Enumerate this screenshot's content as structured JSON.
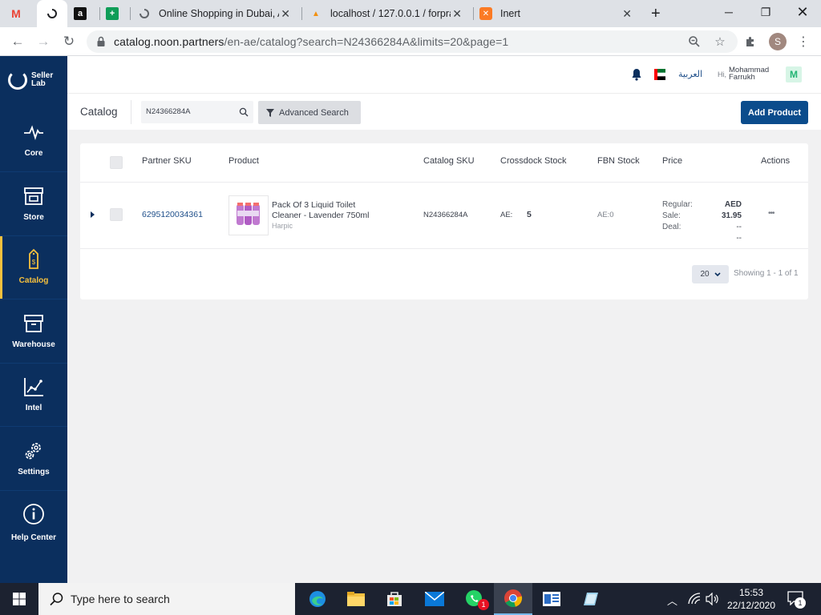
{
  "browser": {
    "tabs": [
      {
        "title": "",
        "icon": "gmail-icon"
      },
      {
        "title": "",
        "icon": "noon-loading-icon"
      },
      {
        "title": "",
        "icon": "amazon-icon"
      },
      {
        "title": "",
        "icon": "sheets-icon"
      },
      {
        "title": "Online Shopping in Dubai, A",
        "icon": "loading-icon"
      },
      {
        "title": "localhost / 127.0.0.1 / forpra",
        "icon": "phpmyadmin-icon"
      },
      {
        "title": "Inert",
        "icon": "xampp-icon"
      }
    ],
    "new_tab": "+",
    "url_host": "catalog.noon.partners",
    "url_path": "/en-ae/catalog?search=N24366284A&limits=20&page=1",
    "profile_initial": "S"
  },
  "sidebar": {
    "logo_line1": "Seller",
    "logo_line2": "Lab",
    "items": [
      {
        "label": "Core",
        "icon": "pulse-icon"
      },
      {
        "label": "Store",
        "icon": "store-icon"
      },
      {
        "label": "Catalog",
        "icon": "price-tag-icon",
        "active": true
      },
      {
        "label": "Warehouse",
        "icon": "warehouse-box-icon"
      },
      {
        "label": "Intel",
        "icon": "line-chart-icon"
      },
      {
        "label": "Settings",
        "icon": "gears-icon"
      },
      {
        "label": "Help Center",
        "icon": "info-icon"
      }
    ]
  },
  "header": {
    "language": "العربية",
    "greeting": "Hi,",
    "user_first": "Mohammad",
    "user_last": "Farrukh",
    "avatar_initial": "M"
  },
  "subheader": {
    "title": "Catalog",
    "search_value": "N24366284A",
    "advanced_search": "Advanced Search",
    "add_product": "Add Product"
  },
  "table": {
    "columns": [
      "Partner SKU",
      "Product",
      "Catalog SKU",
      "Crossdock Stock",
      "FBN Stock",
      "Price",
      "Actions"
    ],
    "rows": [
      {
        "partner_sku": "6295120034361",
        "product_line1": "Pack Of 3 Liquid Toilet",
        "product_line2": "Cleaner - Lavender 750ml",
        "brand": "Harpic",
        "catalog_sku": "N24366284A",
        "crossdock_label": "AE:",
        "crossdock_value": "5",
        "fbn_stock": "AE:0",
        "price_regular_label": "Regular:",
        "price_regular_value": "AED 31.95",
        "price_sale_label": "Sale:",
        "price_sale_value": "--",
        "price_deal_label": "Deal:",
        "price_deal_value": "--",
        "actions": "•••"
      }
    ],
    "page_size": "20",
    "showing": "Showing 1 - 1 of 1"
  },
  "taskbar": {
    "search_placeholder": "Type here to search",
    "time": "15:53",
    "date": "22/12/2020",
    "whatsapp_badge": "1",
    "notif_count": "1"
  },
  "colors": {
    "sidebar_bg": "#0b2f5e",
    "accent_yellow": "#f7c13d",
    "primary_blue": "#0b4c8c",
    "link_blue": "#1f4f8a"
  }
}
